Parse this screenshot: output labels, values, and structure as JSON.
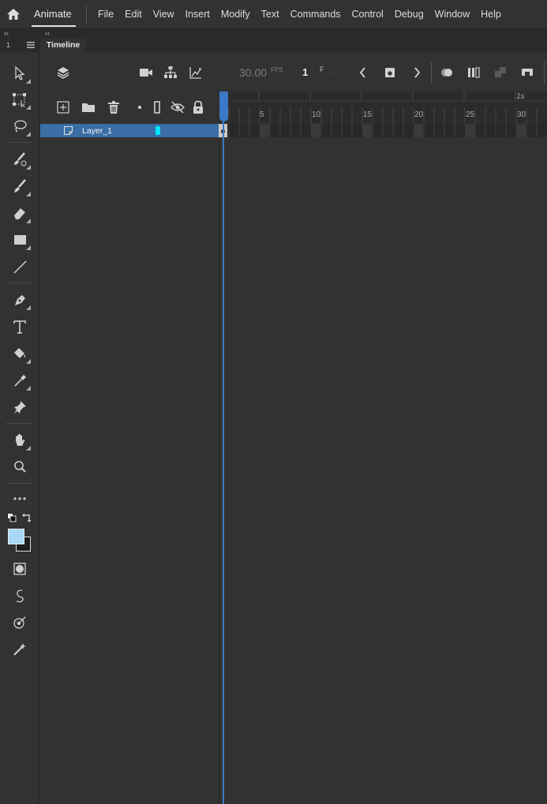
{
  "app": {
    "name": "Animate"
  },
  "menu": [
    "File",
    "Edit",
    "View",
    "Insert",
    "Modify",
    "Text",
    "Commands",
    "Control",
    "Debug",
    "Window",
    "Help"
  ],
  "strip": {
    "collapse_left": "‹‹",
    "collapse_right": "‹‹",
    "number": "1"
  },
  "panel": {
    "tab": "Timeline"
  },
  "timeline": {
    "fps_value": "30.00",
    "fps_unit": "FPS",
    "frame_value": "1",
    "frame_unit": "F",
    "frame_dot": "·",
    "ruler": [
      "5",
      "10",
      "15",
      "20",
      "25",
      "30"
    ],
    "seconds_marker": "1s"
  },
  "layer": {
    "name": "Layer_1",
    "color": "#00e5ff"
  },
  "colors": {
    "fill": "#a8d7f7",
    "stroke": "#1e1e1e",
    "accent": "#3a79c5",
    "selected_layer": "#3a6ea5"
  },
  "tools": [
    "selection-tool-icon",
    "free-transform-tool-icon",
    "lasso-tool-icon",
    "paint-brush-tool-icon",
    "brush-tool-icon",
    "eraser-tool-icon",
    "rectangle-tool-icon",
    "line-tool-icon",
    "pen-tool-icon",
    "text-tool-icon",
    "paint-bucket-tool-icon",
    "eyedropper-tool-icon",
    "pin-tool-icon",
    "hand-tool-icon",
    "zoom-tool-icon",
    "more-tools-icon"
  ]
}
